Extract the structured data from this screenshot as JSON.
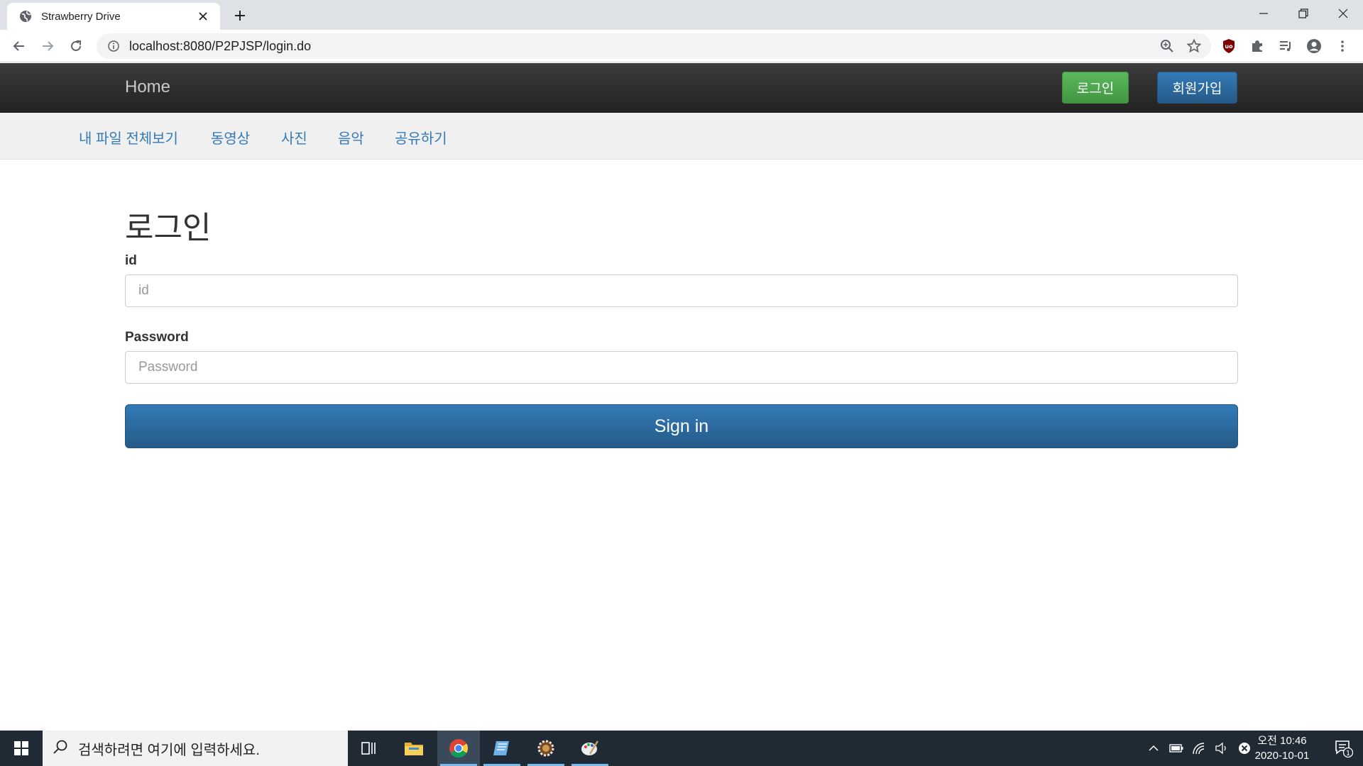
{
  "browser": {
    "tab_title": "Strawberry Drive",
    "url": "localhost:8080/P2PJSP/login.do"
  },
  "navbar": {
    "brand": "Home",
    "login_button": "로그인",
    "signup_button": "회원가입"
  },
  "subnav": {
    "items": [
      "내 파일 전체보기",
      "동영상",
      "사진",
      "음악",
      "공유하기"
    ]
  },
  "form": {
    "title": "로그인",
    "id_label": "id",
    "id_placeholder": "id",
    "password_label": "Password",
    "password_placeholder": "Password",
    "submit_label": "Sign in"
  },
  "taskbar": {
    "search_placeholder": "검색하려면 여기에 입력하세요.",
    "clock_time": "오전 10:46",
    "clock_date": "2020-10-01",
    "notification_count": "1"
  },
  "colors": {
    "primary": "#337ab7",
    "success": "#5cb85c",
    "navbar": "#222222",
    "taskbar": "#202a35"
  }
}
